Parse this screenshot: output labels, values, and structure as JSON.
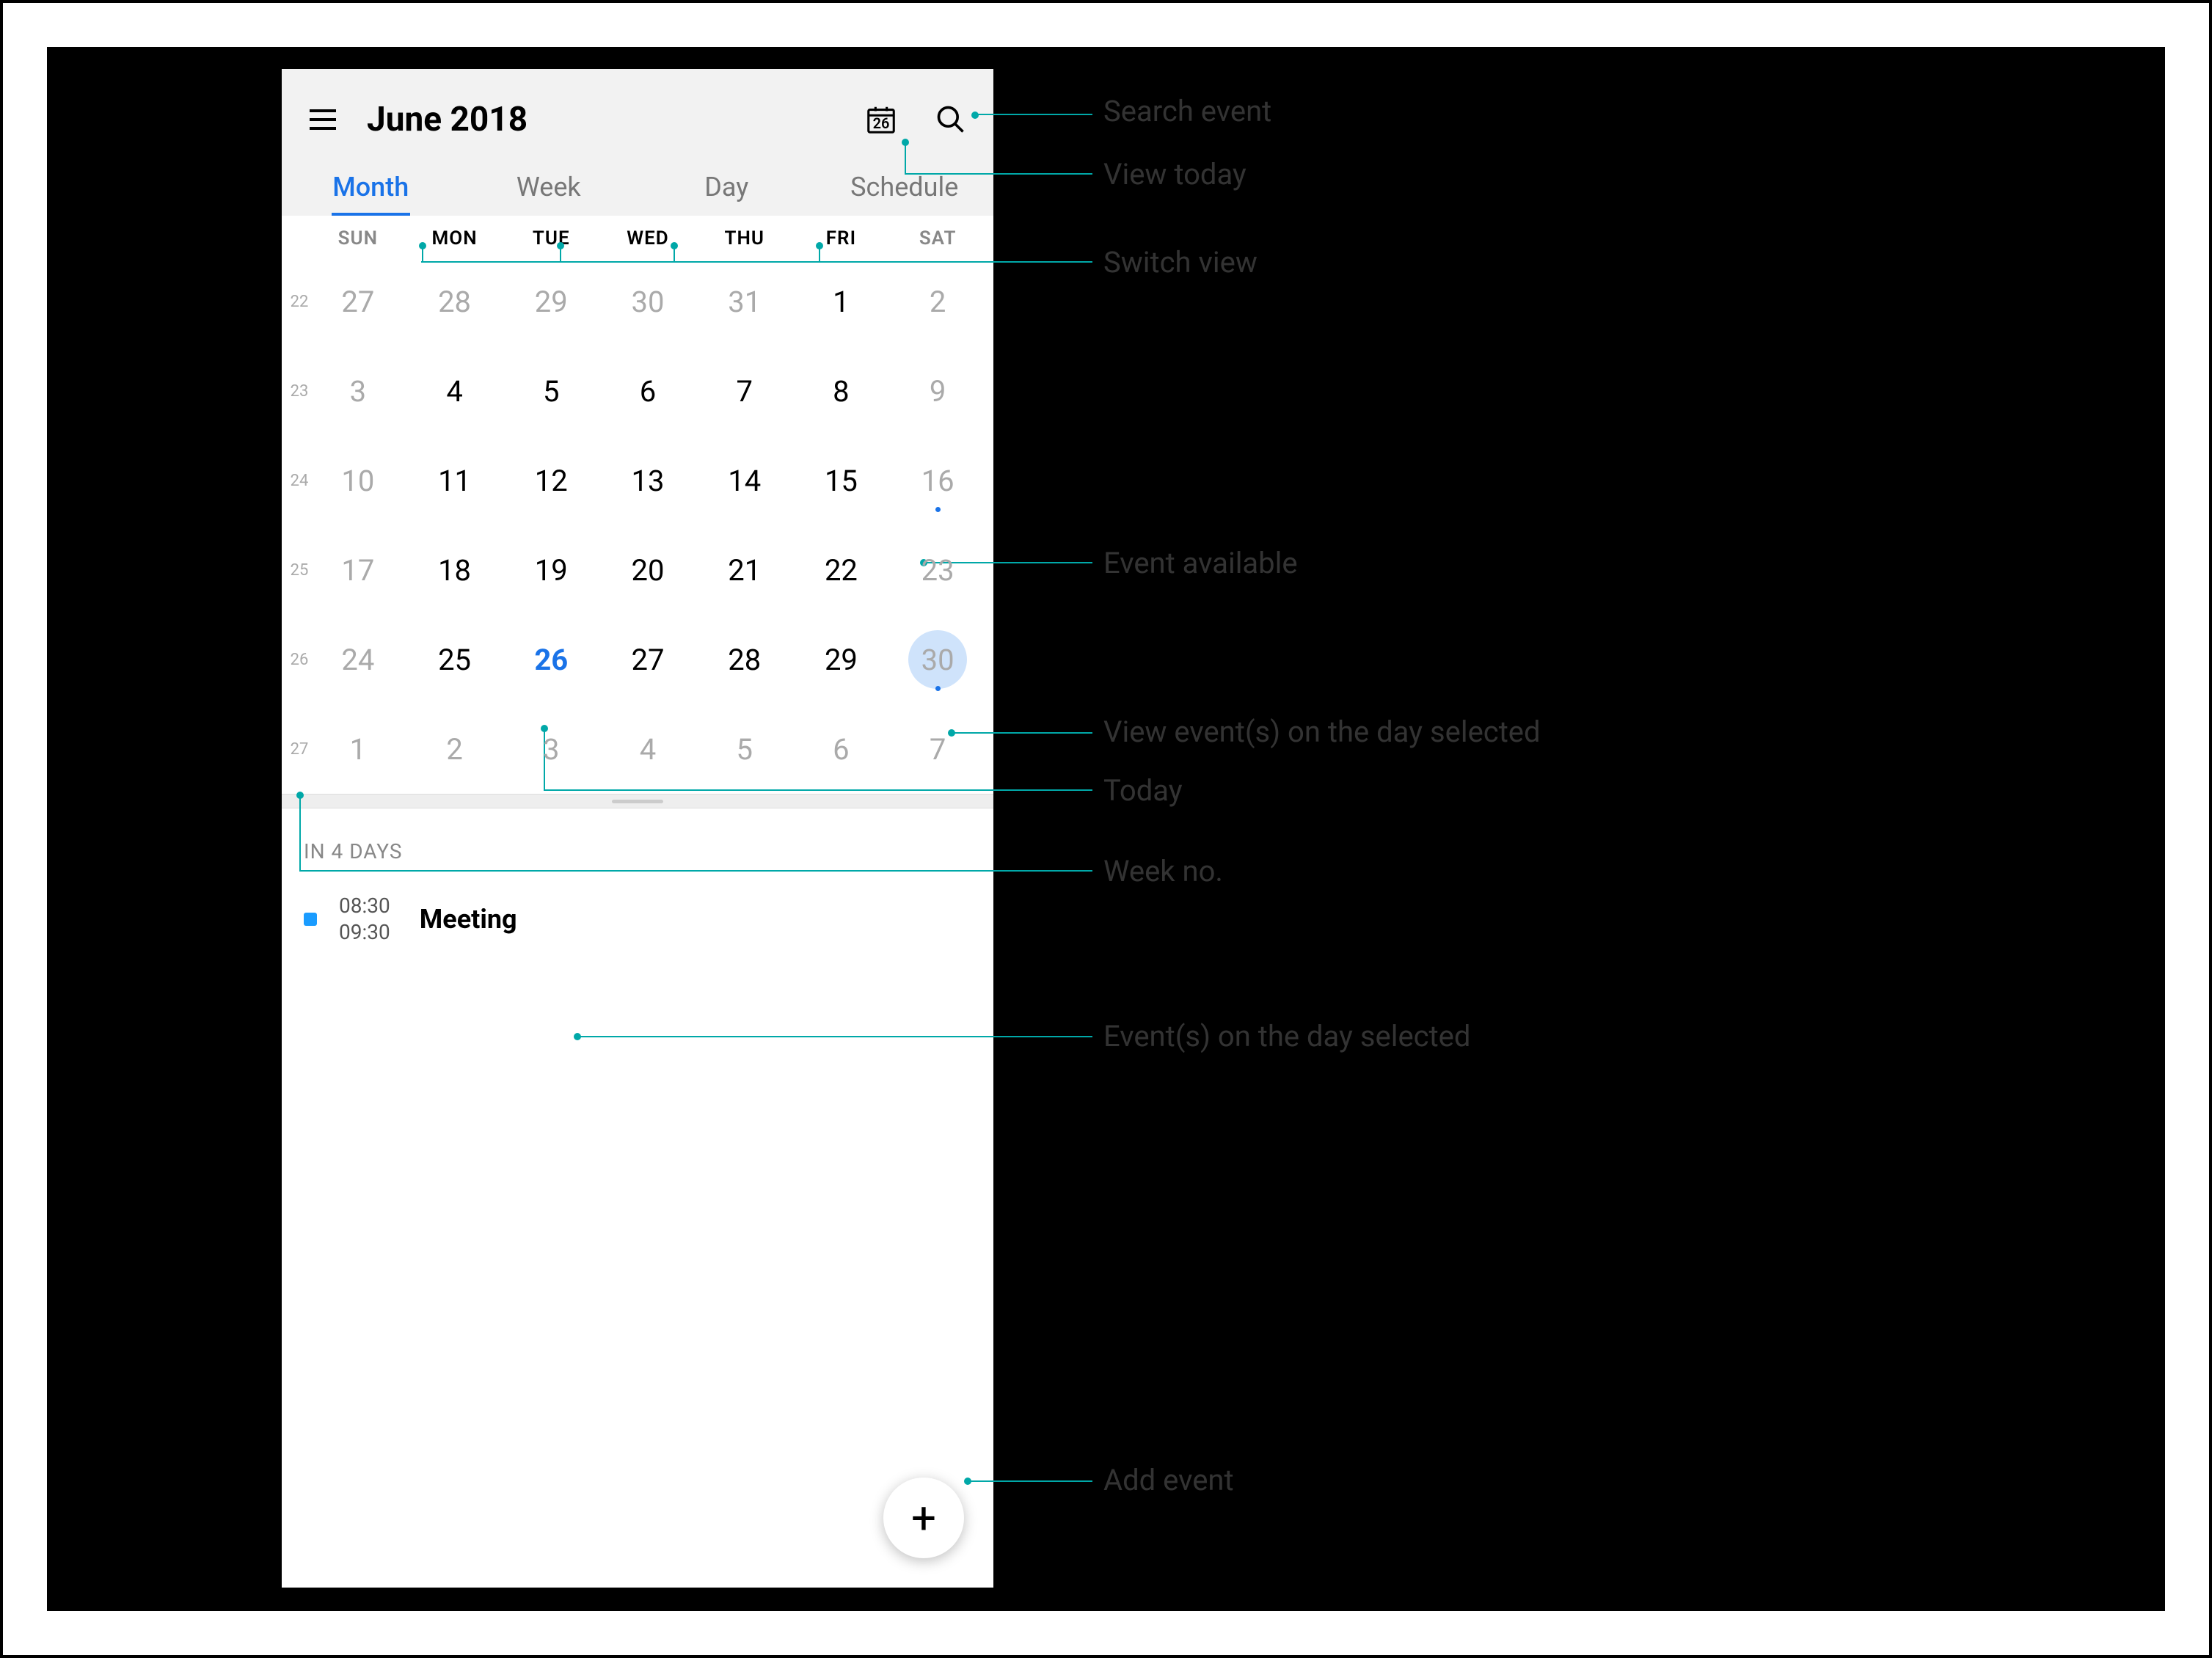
{
  "header": {
    "title": "June 2018",
    "today_badge": "26"
  },
  "tabs": {
    "month": "Month",
    "week": "Week",
    "day": "Day",
    "schedule": "Schedule",
    "active": "month"
  },
  "weekdays": [
    "SUN",
    "MON",
    "TUE",
    "WED",
    "THU",
    "FRI",
    "SAT"
  ],
  "weeks": [
    {
      "wk": "22",
      "days": [
        {
          "n": "27",
          "other": true
        },
        {
          "n": "28",
          "other": true
        },
        {
          "n": "29",
          "other": true
        },
        {
          "n": "30",
          "other": true
        },
        {
          "n": "31",
          "other": true
        },
        {
          "n": "1"
        },
        {
          "n": "2",
          "weekend": true
        }
      ]
    },
    {
      "wk": "23",
      "days": [
        {
          "n": "3",
          "weekend": true
        },
        {
          "n": "4"
        },
        {
          "n": "5"
        },
        {
          "n": "6"
        },
        {
          "n": "7"
        },
        {
          "n": "8"
        },
        {
          "n": "9",
          "weekend": true
        }
      ]
    },
    {
      "wk": "24",
      "days": [
        {
          "n": "10",
          "weekend": true
        },
        {
          "n": "11"
        },
        {
          "n": "12"
        },
        {
          "n": "13"
        },
        {
          "n": "14"
        },
        {
          "n": "15"
        },
        {
          "n": "16",
          "weekend": true,
          "dot": true
        }
      ]
    },
    {
      "wk": "25",
      "days": [
        {
          "n": "17",
          "weekend": true
        },
        {
          "n": "18"
        },
        {
          "n": "19"
        },
        {
          "n": "20"
        },
        {
          "n": "21"
        },
        {
          "n": "22"
        },
        {
          "n": "23",
          "weekend": true
        }
      ]
    },
    {
      "wk": "26",
      "days": [
        {
          "n": "24",
          "weekend": true
        },
        {
          "n": "25"
        },
        {
          "n": "26",
          "today": true
        },
        {
          "n": "27"
        },
        {
          "n": "28"
        },
        {
          "n": "29"
        },
        {
          "n": "30",
          "weekend": true,
          "selected": true,
          "dot": true
        }
      ]
    },
    {
      "wk": "27",
      "days": [
        {
          "n": "1",
          "other": true
        },
        {
          "n": "2",
          "other": true
        },
        {
          "n": "3",
          "other": true
        },
        {
          "n": "4",
          "other": true
        },
        {
          "n": "5",
          "other": true
        },
        {
          "n": "6",
          "other": true
        },
        {
          "n": "7",
          "other": true
        }
      ]
    }
  ],
  "agenda": {
    "header": "IN 4 DAYS",
    "events": [
      {
        "start": "08:30",
        "end": "09:30",
        "title": "Meeting"
      }
    ]
  },
  "callouts": {
    "search": "Search event",
    "today": "View today",
    "switch": "Switch view",
    "event_avail": "Event available",
    "view_events": "View event(s) on the day selected",
    "today_lbl": "Today",
    "weekno": "Week no.",
    "events_selected": "Event(s) on the day selected",
    "add": "Add event"
  },
  "colors": {
    "accent": "#1a73e8",
    "callout": "#00a8a8"
  }
}
